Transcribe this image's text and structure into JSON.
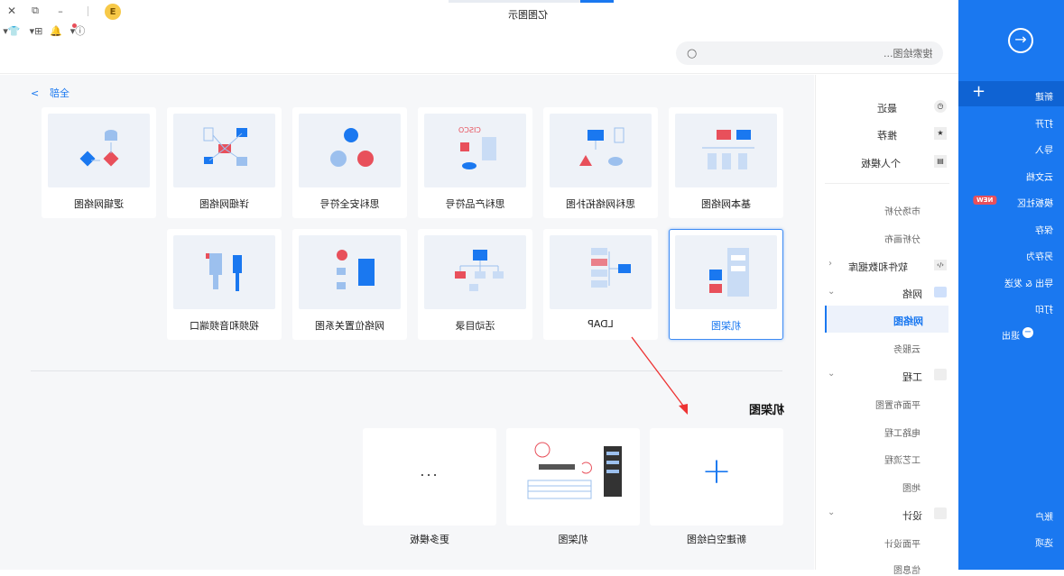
{
  "app": {
    "title": "亿图图示"
  },
  "search": {
    "placeholder": "搜索绘图..."
  },
  "breadcrumb": {
    "label": "全部",
    "arrow": "<"
  },
  "templates_row1": [
    {
      "label": "基本网络图"
    },
    {
      "label": "思科网络拓扑图"
    },
    {
      "label": "思科产品符号",
      "brand": "CISCO"
    },
    {
      "label": "思科安全符号"
    },
    {
      "label": "详细网络图"
    },
    {
      "label": "逻辑网络图"
    }
  ],
  "templates_row2": [
    {
      "label": "机架图"
    },
    {
      "label": "LDAP"
    },
    {
      "label": "活动目录"
    },
    {
      "label": "网络位置关系图"
    },
    {
      "label": "视频和音频端口"
    }
  ],
  "section": {
    "title": "机架图"
  },
  "bottom_cards": [
    {
      "label": "新建空白绘图",
      "icon": "+"
    },
    {
      "label": "机架图"
    },
    {
      "label": "更多模板",
      "icon": "..."
    }
  ],
  "right_top": [
    {
      "label": "最近",
      "icon": "clock-icon"
    },
    {
      "label": "推荐",
      "icon": "star-icon"
    },
    {
      "label": "个人模板",
      "icon": "template-icon"
    }
  ],
  "right_cats": [
    {
      "label": "市场分析",
      "level": "sub"
    },
    {
      "label": "分析画布",
      "level": "sub"
    },
    {
      "label": "软件和数据库",
      "level": "main"
    },
    {
      "label": "网络",
      "level": "main"
    },
    {
      "label": "网络图",
      "level": "active"
    },
    {
      "label": "云服务",
      "level": "sub"
    },
    {
      "label": "工程",
      "level": "main"
    },
    {
      "label": "平面布置图",
      "level": "sub"
    },
    {
      "label": "电路工程",
      "level": "sub"
    },
    {
      "label": "工艺流程",
      "level": "sub"
    },
    {
      "label": "地图",
      "level": "sub"
    },
    {
      "label": "设计",
      "level": "main"
    },
    {
      "label": "平面设计",
      "level": "sub"
    },
    {
      "label": "信息图",
      "level": "sub"
    }
  ],
  "sidebar": {
    "new": "新建",
    "open": "打开",
    "import": "导入",
    "cloud": "云文档",
    "community": "模板社区",
    "new_badge": "NEW",
    "save": "保存",
    "save_as": "另存为",
    "export": "导出 & 发送",
    "print": "打印",
    "exit": "退出",
    "account": "账户",
    "options": "选项"
  },
  "colors": {
    "accent": "#1a78f0",
    "red": "#e8505b"
  }
}
